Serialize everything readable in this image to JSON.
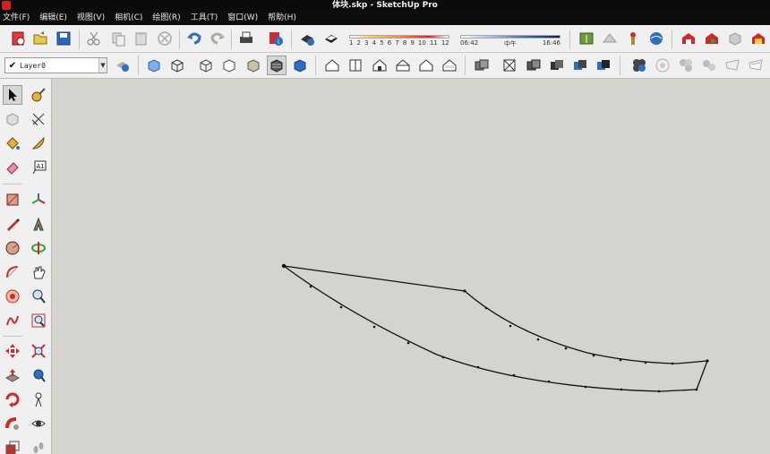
{
  "window": {
    "title": "体块.skp - SketchUp Pro"
  },
  "menu": [
    {
      "label": "文件(F)"
    },
    {
      "label": "编辑(E)"
    },
    {
      "label": "视图(V)"
    },
    {
      "label": "相机(C)"
    },
    {
      "label": "绘图(R)"
    },
    {
      "label": "工具(T)"
    },
    {
      "label": "窗口(W)"
    },
    {
      "label": "帮助(H)"
    }
  ],
  "shadow_settings": {
    "months": [
      "1",
      "2",
      "3",
      "4",
      "5",
      "6",
      "7",
      "8",
      "9",
      "10",
      "11",
      "12"
    ],
    "time_start": "06:42",
    "time_mid": "中午",
    "time_end": "16:46"
  },
  "layer": {
    "current": "Layer0"
  },
  "colors": {
    "accent_red": "#d12a2a",
    "accent_blue": "#2b6fc0",
    "canvas_bg": "#d4d3ce",
    "toolbar_bg": "#f0f0f0",
    "titlebar_bg": "#0b0b0b",
    "edge_color": "#111111"
  }
}
